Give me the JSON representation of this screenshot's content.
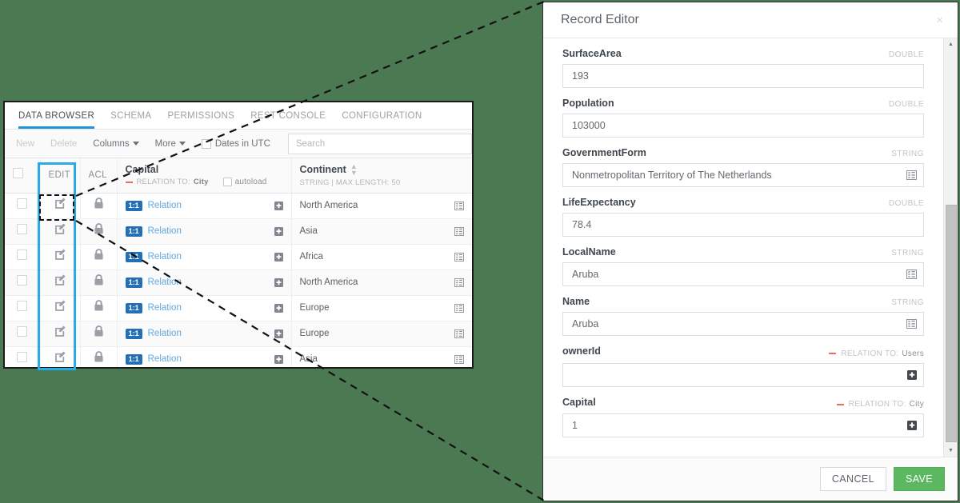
{
  "background_color": "#4b7a52",
  "accent": {
    "highlight_box": "#29abe8",
    "tab_active": "#2196d6",
    "relation_badge": "#2470b8",
    "relation_dash": "#e8705a",
    "save_button": "#5cb860"
  },
  "browser": {
    "tabs": [
      {
        "label": "DATA BROWSER",
        "active": true
      },
      {
        "label": "SCHEMA",
        "active": false
      },
      {
        "label": "PERMISSIONS",
        "active": false
      },
      {
        "label": "REST CONSOLE",
        "active": false
      },
      {
        "label": "CONFIGURATION",
        "active": false
      }
    ],
    "toolbar": {
      "new_label": "New",
      "delete_label": "Delete",
      "columns_label": "Columns",
      "more_label": "More",
      "dates_utc_label": "Dates in UTC",
      "dates_utc_checked": false,
      "search_placeholder": "Search"
    },
    "columns": {
      "select_all": "",
      "edit": "EDIT",
      "acl": "ACL",
      "capital": {
        "title": "Capital",
        "relation_prefix": "RELATION TO:",
        "relation_target": "City",
        "autoload_label": "autoload",
        "autoload_checked": false
      },
      "continent": {
        "title": "Continent",
        "meta": "STRING | MAX LENGTH: 50"
      }
    },
    "rows": [
      {
        "capital_badge": "1:1",
        "capital_link": "Relation",
        "continent": "North America"
      },
      {
        "capital_badge": "1:1",
        "capital_link": "Relation",
        "continent": "Asia"
      },
      {
        "capital_badge": "1:1",
        "capital_link": "Relation",
        "continent": "Africa"
      },
      {
        "capital_badge": "1:1",
        "capital_link": "Relation",
        "continent": "North America"
      },
      {
        "capital_badge": "1:1",
        "capital_link": "Relation",
        "continent": "Europe"
      },
      {
        "capital_badge": "1:1",
        "capital_link": "Relation",
        "continent": "Europe"
      },
      {
        "capital_badge": "1:1",
        "capital_link": "Relation",
        "continent": "Asia"
      }
    ]
  },
  "record_editor": {
    "title": "Record Editor",
    "close_label": "×",
    "fields": [
      {
        "label": "SurfaceArea",
        "type": "DOUBLE",
        "value": "193",
        "kind": "plain"
      },
      {
        "label": "Population",
        "type": "DOUBLE",
        "value": "103000",
        "kind": "plain"
      },
      {
        "label": "GovernmentForm",
        "type": "STRING",
        "value": "Nonmetropolitan Territory of The Netherlands",
        "kind": "expand"
      },
      {
        "label": "LifeExpectancy",
        "type": "DOUBLE",
        "value": "78.4",
        "kind": "plain"
      },
      {
        "label": "LocalName",
        "type": "STRING",
        "value": "Aruba",
        "kind": "expand"
      },
      {
        "label": "Name",
        "type": "STRING",
        "value": "Aruba",
        "kind": "expand"
      },
      {
        "label": "ownerId",
        "relation_prefix": "RELATION TO:",
        "relation_target": "Users",
        "value": "",
        "kind": "relation"
      },
      {
        "label": "Capital",
        "relation_prefix": "RELATION TO:",
        "relation_target": "City",
        "value": "1",
        "kind": "relation"
      }
    ],
    "footer": {
      "cancel_label": "CANCEL",
      "save_label": "SAVE"
    }
  }
}
